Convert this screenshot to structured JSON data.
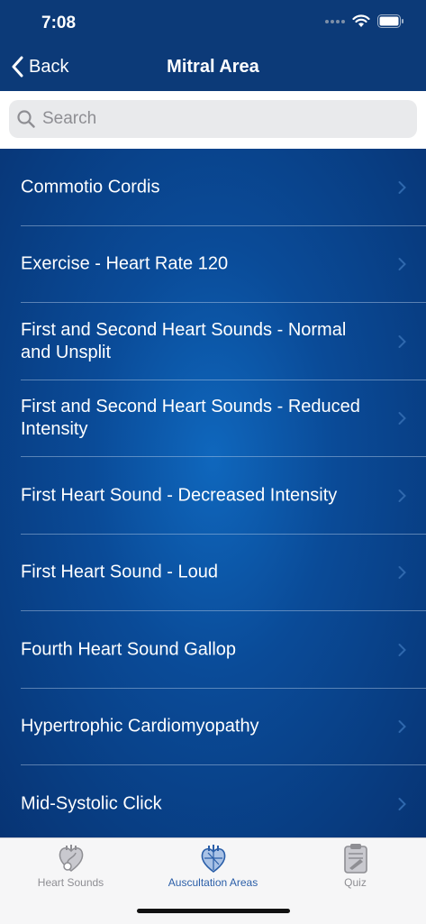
{
  "status": {
    "time": "7:08"
  },
  "nav": {
    "back_label": "Back",
    "title": "Mitral Area"
  },
  "search": {
    "placeholder": "Search",
    "value": ""
  },
  "list": {
    "items": [
      {
        "label": "Commotio Cordis"
      },
      {
        "label": "Exercise - Heart Rate 120"
      },
      {
        "label": "First and Second Heart Sounds - Normal and Unsplit"
      },
      {
        "label": "First and Second Heart Sounds - Reduced Intensity"
      },
      {
        "label": "First Heart Sound - Decreased Intensity"
      },
      {
        "label": "First Heart Sound - Loud"
      },
      {
        "label": "Fourth Heart Sound Gallop"
      },
      {
        "label": "Hypertrophic Cardiomyopathy"
      },
      {
        "label": "Mid-Systolic Click"
      }
    ]
  },
  "tabs": [
    {
      "label": "Heart Sounds",
      "icon": "heart-stethoscope-icon",
      "active": false
    },
    {
      "label": "Auscultation Areas",
      "icon": "heart-areas-icon",
      "active": true
    },
    {
      "label": "Quiz",
      "icon": "clipboard-icon",
      "active": false
    }
  ],
  "colors": {
    "nav_background": "#0c3a78",
    "list_gradient_center": "#0f67bd",
    "list_gradient_edge": "#073474",
    "tab_active": "#2a5ea8",
    "tab_inactive": "#8e8e93"
  }
}
